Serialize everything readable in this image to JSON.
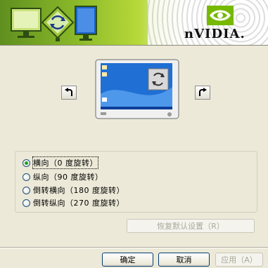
{
  "banner": {
    "logo_text": "nVIDIA."
  },
  "rotation": {
    "options": [
      {
        "label": "横向（0 度旋转）",
        "selected": true
      },
      {
        "label": "纵向（90 度旋转）",
        "selected": false
      },
      {
        "label": "倒转横向（180 度旋转）",
        "selected": false
      },
      {
        "label": "倒转纵向（270 度旋转）",
        "selected": false
      }
    ],
    "restore_default_label": "恢复默认设置（R）"
  },
  "footer": {
    "ok_label": "确定",
    "cancel_label": "取消",
    "apply_label": "应用（A）"
  },
  "colors": {
    "accent_green": "#76b900",
    "xp_face": "#ece9d8",
    "button_border": "#003c74"
  }
}
